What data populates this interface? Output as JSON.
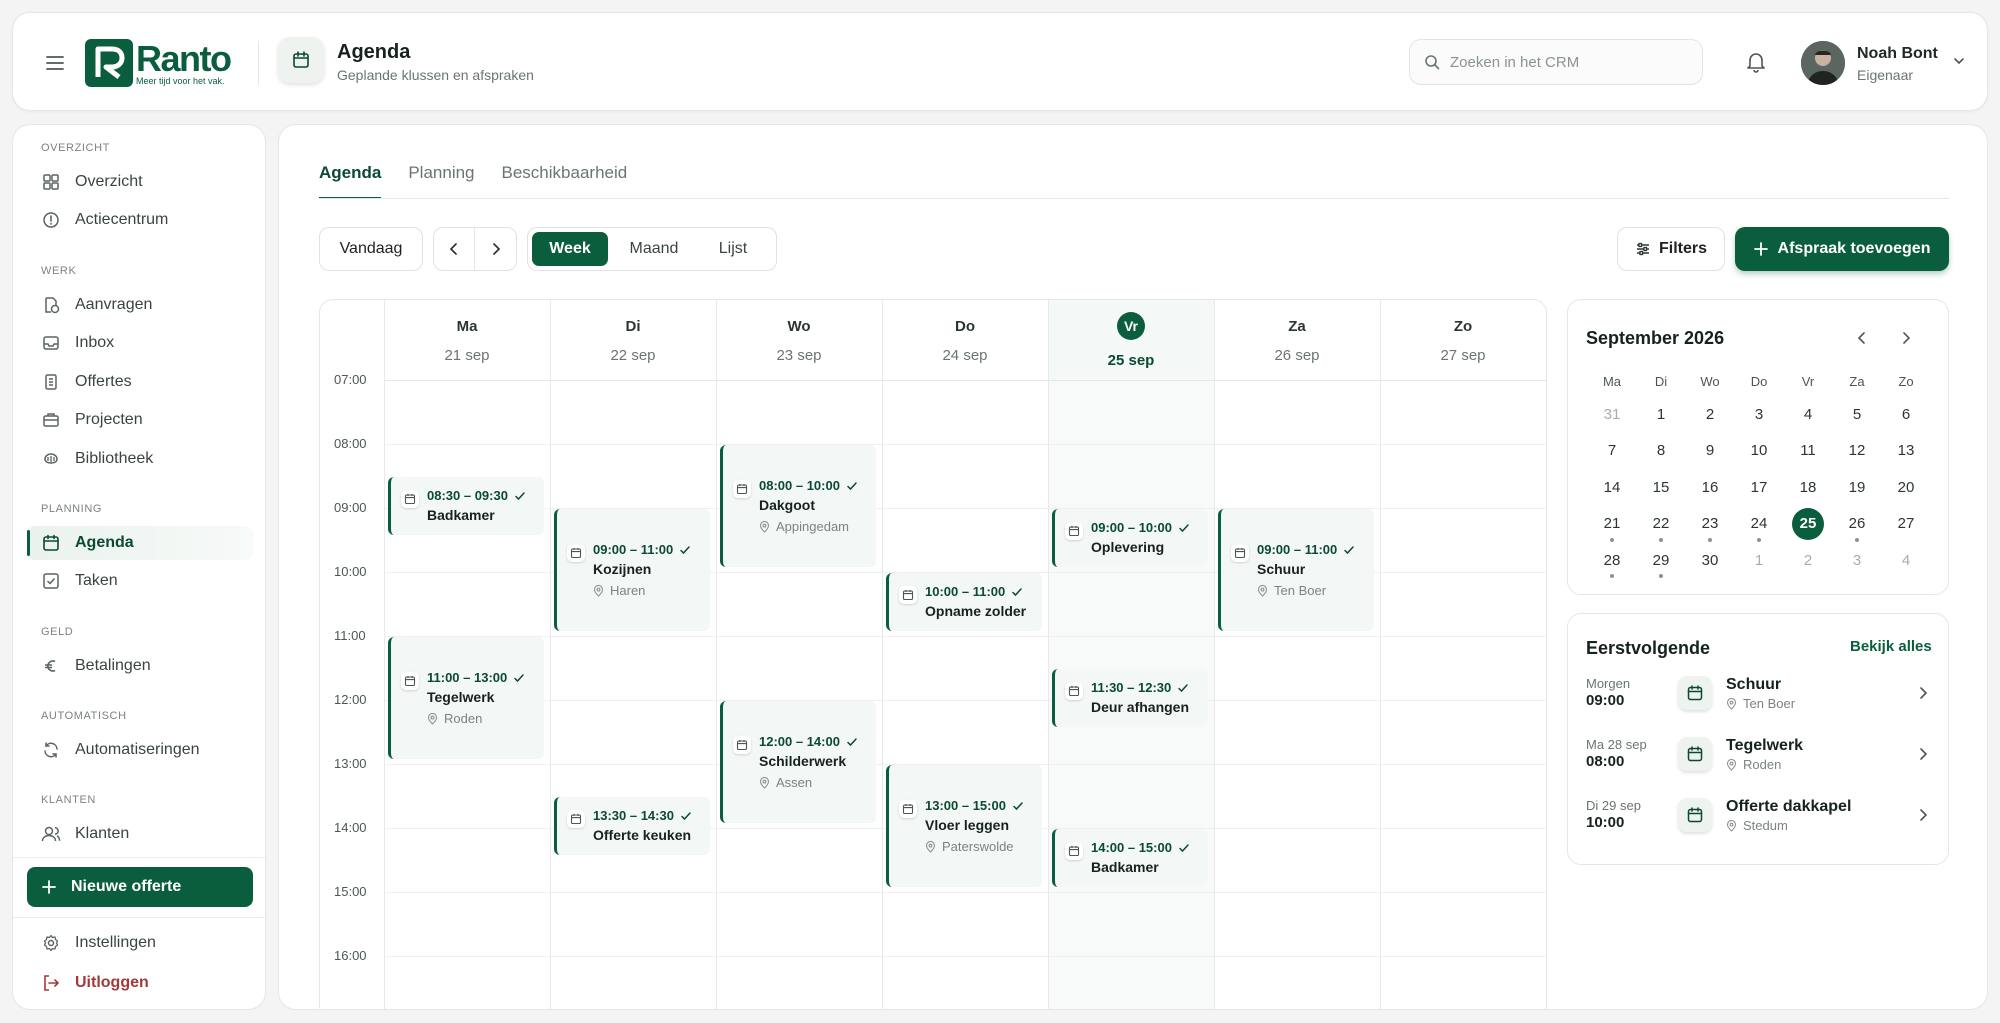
{
  "brand": {
    "name": "Ranto",
    "tagline": "Meer tijd voor het vak.",
    "color": "#0b5e3d"
  },
  "header": {
    "title": "Agenda",
    "subtitle": "Geplande klussen en afspraken",
    "search_placeholder": "Zoeken in het CRM",
    "user": {
      "name": "Noah Bont",
      "role": "Eigenaar"
    }
  },
  "sidebar": {
    "sections": [
      {
        "label": "OVERZICHT",
        "items": [
          {
            "label": "Overzicht",
            "icon": "grid-icon"
          },
          {
            "label": "Actiecentrum",
            "icon": "alert-circle-icon"
          }
        ]
      },
      {
        "label": "WERK",
        "items": [
          {
            "label": "Aanvragen",
            "icon": "file-clock-icon"
          },
          {
            "label": "Inbox",
            "icon": "inbox-icon"
          },
          {
            "label": "Offertes",
            "icon": "document-icon"
          },
          {
            "label": "Projecten",
            "icon": "briefcase-icon"
          },
          {
            "label": "Bibliotheek",
            "icon": "library-icon"
          }
        ]
      },
      {
        "label": "PLANNING",
        "items": [
          {
            "label": "Agenda",
            "icon": "calendar-icon",
            "active": true
          },
          {
            "label": "Taken",
            "icon": "checkbox-icon"
          }
        ]
      },
      {
        "label": "GELD",
        "items": [
          {
            "label": "Betalingen",
            "icon": "euro-icon"
          }
        ]
      },
      {
        "label": "AUTOMATISCH",
        "items": [
          {
            "label": "Automatiseringen",
            "icon": "refresh-icon"
          }
        ]
      },
      {
        "label": "KLANTEN",
        "items": [
          {
            "label": "Klanten",
            "icon": "users-icon"
          }
        ]
      }
    ],
    "new_offer": "Nieuwe offerte",
    "settings": "Instellingen",
    "logout": "Uitloggen"
  },
  "tabs": [
    "Agenda",
    "Planning",
    "Beschikbaarheid"
  ],
  "toolbar": {
    "today": "Vandaag",
    "views": [
      "Week",
      "Maand",
      "Lijst"
    ],
    "active_view": "Week",
    "filters": "Filters",
    "add": "Afspraak toevoegen"
  },
  "week": {
    "days": [
      {
        "name": "Ma",
        "date": "21 sep"
      },
      {
        "name": "Di",
        "date": "22 sep"
      },
      {
        "name": "Wo",
        "date": "23 sep"
      },
      {
        "name": "Do",
        "date": "24 sep"
      },
      {
        "name": "Vr",
        "date": "25 sep",
        "today": true,
        "badge": "Vr"
      },
      {
        "name": "Za",
        "date": "26 sep"
      },
      {
        "name": "Zo",
        "date": "27 sep"
      }
    ],
    "hours": [
      "07:00",
      "08:00",
      "09:00",
      "10:00",
      "11:00",
      "12:00",
      "13:00",
      "14:00",
      "15:00",
      "16:00"
    ],
    "events": [
      {
        "day": 0,
        "start": 8.5,
        "end": 9.5,
        "time": "08:30 – 09:30",
        "title": "Badkamer",
        "location": ""
      },
      {
        "day": 0,
        "start": 11,
        "end": 13,
        "time": "11:00 – 13:00",
        "title": "Tegelwerk",
        "location": "Roden"
      },
      {
        "day": 1,
        "start": 9,
        "end": 11,
        "time": "09:00 – 11:00",
        "title": "Kozijnen",
        "location": "Haren"
      },
      {
        "day": 1,
        "start": 13.5,
        "end": 14.5,
        "time": "13:30 – 14:30",
        "title": "Offerte keuken",
        "location": ""
      },
      {
        "day": 2,
        "start": 8,
        "end": 10,
        "time": "08:00 – 10:00",
        "title": "Dakgoot",
        "location": "Appingedam"
      },
      {
        "day": 2,
        "start": 12,
        "end": 14,
        "time": "12:00 – 14:00",
        "title": "Schilderwerk",
        "location": "Assen"
      },
      {
        "day": 3,
        "start": 10,
        "end": 11,
        "time": "10:00 – 11:00",
        "title": "Opname zolder",
        "location": ""
      },
      {
        "day": 3,
        "start": 13,
        "end": 15,
        "time": "13:00 – 15:00",
        "title": "Vloer leggen",
        "location": "Paterswolde"
      },
      {
        "day": 4,
        "start": 9,
        "end": 10,
        "time": "09:00 – 10:00",
        "title": "Oplevering",
        "location": ""
      },
      {
        "day": 4,
        "start": 11.5,
        "end": 12.5,
        "time": "11:30 – 12:30",
        "title": "Deur afhangen",
        "location": ""
      },
      {
        "day": 4,
        "start": 14,
        "end": 15,
        "time": "14:00 – 15:00",
        "title": "Badkamer",
        "location": ""
      },
      {
        "day": 5,
        "start": 9,
        "end": 11,
        "time": "09:00 – 11:00",
        "title": "Schuur",
        "location": "Ten Boer"
      }
    ]
  },
  "mini_calendar": {
    "title": "September 2026",
    "weekdays": [
      "Ma",
      "Di",
      "Wo",
      "Do",
      "Vr",
      "Za",
      "Zo"
    ],
    "weeks": [
      [
        {
          "d": "31",
          "muted": true
        },
        {
          "d": "1"
        },
        {
          "d": "2"
        },
        {
          "d": "3"
        },
        {
          "d": "4"
        },
        {
          "d": "5"
        },
        {
          "d": "6"
        }
      ],
      [
        {
          "d": "7"
        },
        {
          "d": "8"
        },
        {
          "d": "9"
        },
        {
          "d": "10"
        },
        {
          "d": "11"
        },
        {
          "d": "12"
        },
        {
          "d": "13"
        }
      ],
      [
        {
          "d": "14"
        },
        {
          "d": "15"
        },
        {
          "d": "16"
        },
        {
          "d": "17"
        },
        {
          "d": "18"
        },
        {
          "d": "19"
        },
        {
          "d": "20"
        }
      ],
      [
        {
          "d": "21",
          "dot": true
        },
        {
          "d": "22",
          "dot": true
        },
        {
          "d": "23",
          "dot": true
        },
        {
          "d": "24",
          "dot": true
        },
        {
          "d": "25",
          "selected": true
        },
        {
          "d": "26",
          "dot": true
        },
        {
          "d": "27"
        }
      ],
      [
        {
          "d": "28",
          "dot": true
        },
        {
          "d": "29",
          "dot": true
        },
        {
          "d": "30"
        },
        {
          "d": "1",
          "muted": true
        },
        {
          "d": "2",
          "muted": true
        },
        {
          "d": "3",
          "muted": true
        },
        {
          "d": "4",
          "muted": true
        }
      ]
    ]
  },
  "upcoming": {
    "title": "Eerstvolgende",
    "see_all": "Bekijk alles",
    "items": [
      {
        "when": "Morgen",
        "time": "09:00",
        "title": "Schuur",
        "location": "Ten Boer"
      },
      {
        "when": "Ma 28 sep",
        "time": "08:00",
        "title": "Tegelwerk",
        "location": "Roden"
      },
      {
        "when": "Di 29 sep",
        "time": "10:00",
        "title": "Offerte dakkapel",
        "location": "Stedum"
      }
    ]
  }
}
